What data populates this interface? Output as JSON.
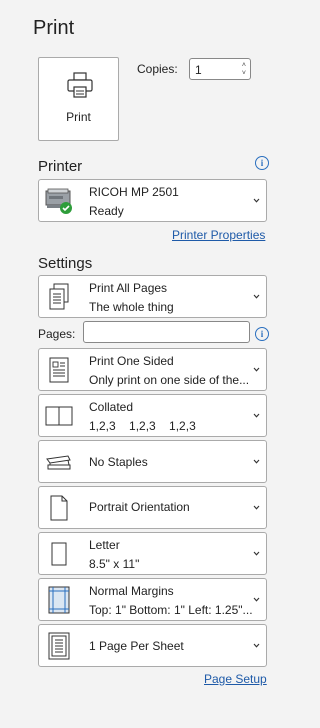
{
  "title": "Print",
  "print_button": {
    "label": "Print"
  },
  "copies": {
    "label": "Copies:",
    "value": "1"
  },
  "printer": {
    "section_title": "Printer",
    "name": "RICOH MP 2501",
    "status": "Ready",
    "properties_link": "Printer Properties"
  },
  "settings": {
    "section_title": "Settings",
    "pages_label": "Pages:",
    "pages_value": "",
    "items": [
      {
        "line1": "Print All Pages",
        "line2": "The whole thing"
      },
      {
        "line1": "Print One Sided",
        "line2": "Only print on one side of the..."
      },
      {
        "line1": "Collated",
        "line2": "1,2,3    1,2,3    1,2,3"
      },
      {
        "line1": "No Staples",
        "line2": ""
      },
      {
        "line1": "Portrait Orientation",
        "line2": ""
      },
      {
        "line1": "Letter",
        "line2": "8.5\" x 11\""
      },
      {
        "line1": "Normal Margins",
        "line2": "Top: 1\" Bottom: 1\" Left: 1.25\"..."
      },
      {
        "line1": "1 Page Per Sheet",
        "line2": ""
      }
    ]
  },
  "page_setup_link": "Page Setup",
  "colors": {
    "link": "#1e5aa8",
    "ready": "#2e9d3a"
  }
}
